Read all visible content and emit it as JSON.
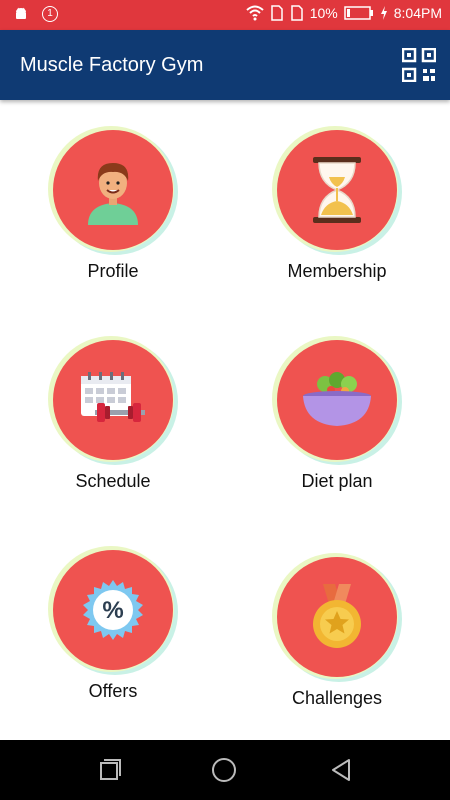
{
  "status": {
    "battery": "10%",
    "time": "8:04PM",
    "notification_count": "1"
  },
  "appbar": {
    "title": "Muscle Factory Gym",
    "qr_icon": "qr-code-icon"
  },
  "menu": {
    "items": [
      {
        "label": "Profile",
        "icon": "profile-avatar-icon"
      },
      {
        "label": "Membership",
        "icon": "hourglass-icon"
      },
      {
        "label": "Schedule",
        "icon": "calendar-dumbbell-icon"
      },
      {
        "label": "Diet plan",
        "icon": "salad-bowl-icon"
      },
      {
        "label": "Offers",
        "icon": "percent-badge-icon"
      },
      {
        "label": "Challenges",
        "icon": "medal-icon"
      }
    ]
  },
  "colors": {
    "status_bar": "#e0373d",
    "app_bar": "#0f3a73",
    "circle": "#ef5350"
  },
  "navbar": {
    "icons": [
      "recent-apps-icon",
      "home-icon",
      "back-icon"
    ]
  }
}
